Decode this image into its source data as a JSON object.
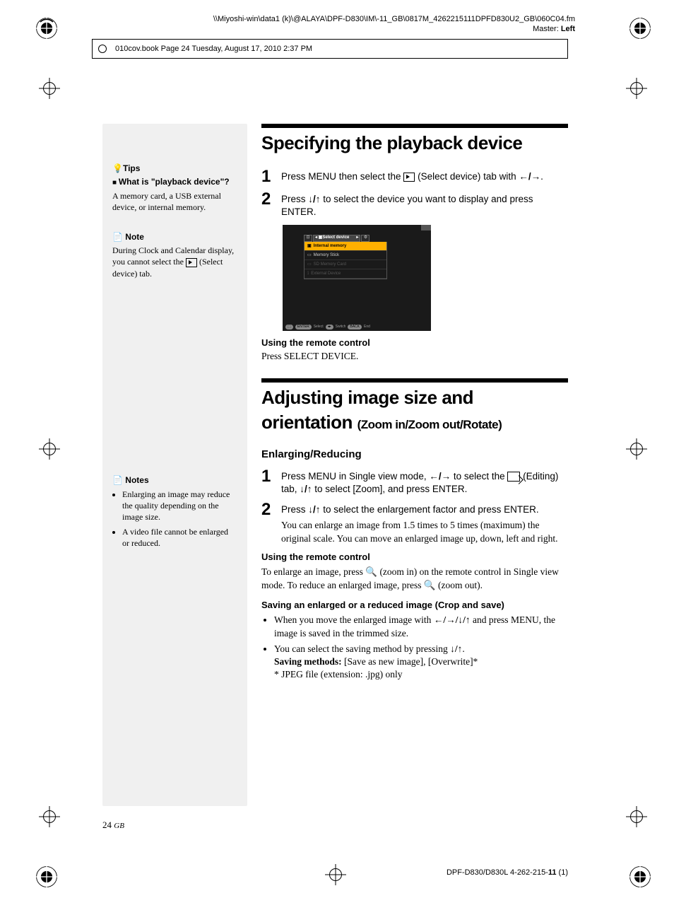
{
  "header": {
    "path": "\\\\Miyoshi-win\\data1 (k)\\@ALAYA\\DPF-D830\\IM\\-11_GB\\0817M_4262215111DPFD830U2_GB\\060C04.fm",
    "master_label": "Master:",
    "master_side": "Left",
    "book_info": "010cov.book  Page 24  Tuesday, August 17, 2010  2:37 PM"
  },
  "sidebar": {
    "tips_label": "Tips",
    "tips_q": "What is \"playback device\"?",
    "tips_body": "A memory card, a USB external device, or internal memory.",
    "note_label": "Note",
    "note_body_pre": "During Clock and Calendar display, you cannot select the ",
    "note_body_post": " (Select device) tab.",
    "notes2_label": "Notes",
    "notes2_items": [
      "Enlarging an image may reduce the quality depending on the image size.",
      "A video file cannot be enlarged or reduced."
    ]
  },
  "section1": {
    "title": "Specifying the playback device",
    "step1_pre": "Press MENU then select the ",
    "step1_post": " (Select device) tab with ",
    "step1_end": ".",
    "step2_pre": "Press ",
    "step2_post": " to select the device you want to display and press ENTER.",
    "screenshot": {
      "tab_active": "Select device",
      "items": [
        {
          "label": "Internal memory",
          "state": "sel"
        },
        {
          "label": "Memory Stick",
          "state": "norm"
        },
        {
          "label": "SD Memory Card",
          "state": "dis"
        },
        {
          "label": "External Device",
          "state": "dis"
        }
      ],
      "footer": {
        "select": "Select",
        "switch": "Switch",
        "end": "End"
      }
    },
    "remote_hdr": "Using the remote control",
    "remote_body": "Press SELECT DEVICE."
  },
  "section2": {
    "title_a": "Adjusting image size and orientation",
    "title_b": "(Zoom in/Zoom out/Rotate)",
    "sub": "Enlarging/Reducing",
    "step1_a": "Press MENU in Single view mode, ",
    "step1_b": " to select the ",
    "step1_c": " (Editing) tab, ",
    "step1_d": " to select [Zoom], and press ENTER.",
    "step2_a": "Press ",
    "step2_b": " to select the enlargement factor and press ENTER.",
    "step2_detail": "You can enlarge an image from 1.5 times to 5 times (maximum) the original scale. You can move an enlarged image up, down, left and right.",
    "remote_hdr": "Using the remote control",
    "remote_body": "To enlarge an image, press 🔍 (zoom in) on the remote control in Single view mode. To reduce an enlarged image, press 🔍 (zoom out).",
    "save_hdr": "Saving an enlarged or a reduced image (Crop and save)",
    "save_b1_a": "When you move the enlarged image with ",
    "save_b1_b": " and press MENU, the image is saved in the trimmed size.",
    "save_b2_a": "You can select the saving method by pressing ",
    "save_b2_b": ".",
    "save_methods_label": "Saving methods:",
    "save_methods_val": " [Save as new image],  [Overwrite]*",
    "save_note": "* JPEG file (extension: .jpg) only"
  },
  "footer": {
    "page_num": "24",
    "page_gb": "GB",
    "doc_id": "DPF-D830/D830L 4-262-215-",
    "doc_rev": "11",
    "doc_suffix": " (1)"
  },
  "glyphs": {
    "left": "←",
    "right": "→",
    "up": "↑",
    "down": "↓",
    "leftright": "←/→",
    "updown": "↓/↑",
    "fourway": "←/→/↓/↑"
  }
}
